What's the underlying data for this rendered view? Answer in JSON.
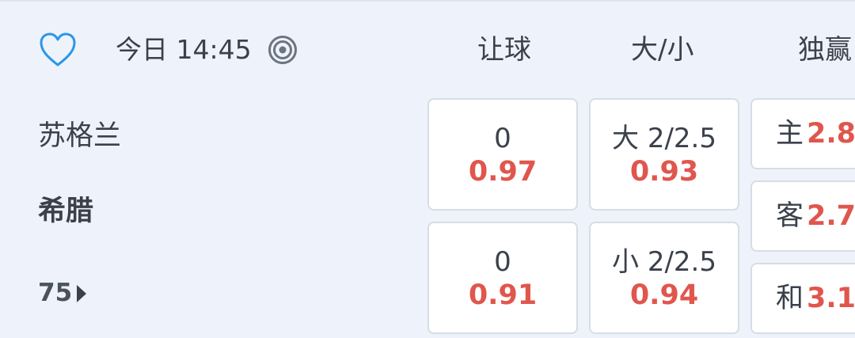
{
  "match": {
    "time": "今日 14:45",
    "home_team": "苏格兰",
    "away_team": "希腊",
    "minute": "75"
  },
  "columns": {
    "handicap": "让球",
    "over_under": "大/小",
    "win": "独赢"
  },
  "handicap": [
    {
      "line": "0",
      "odds": "0.97"
    },
    {
      "line": "0",
      "odds": "0.91"
    }
  ],
  "over_under": [
    {
      "line": "大 2/2.5",
      "odds": "0.93"
    },
    {
      "line": "小 2/2.5",
      "odds": "0.94"
    }
  ],
  "win": [
    {
      "label": "主",
      "odds": "2.8"
    },
    {
      "label": "客",
      "odds": "2.7"
    },
    {
      "label": "和",
      "odds": "3.1"
    }
  ],
  "icons": {
    "favorite": "heart-outline-icon",
    "live": "target-icon",
    "expand": "triangle-right-icon"
  },
  "colors": {
    "odds": "#e0564d",
    "heart": "#2a97e8",
    "background": "#eef3fb"
  }
}
